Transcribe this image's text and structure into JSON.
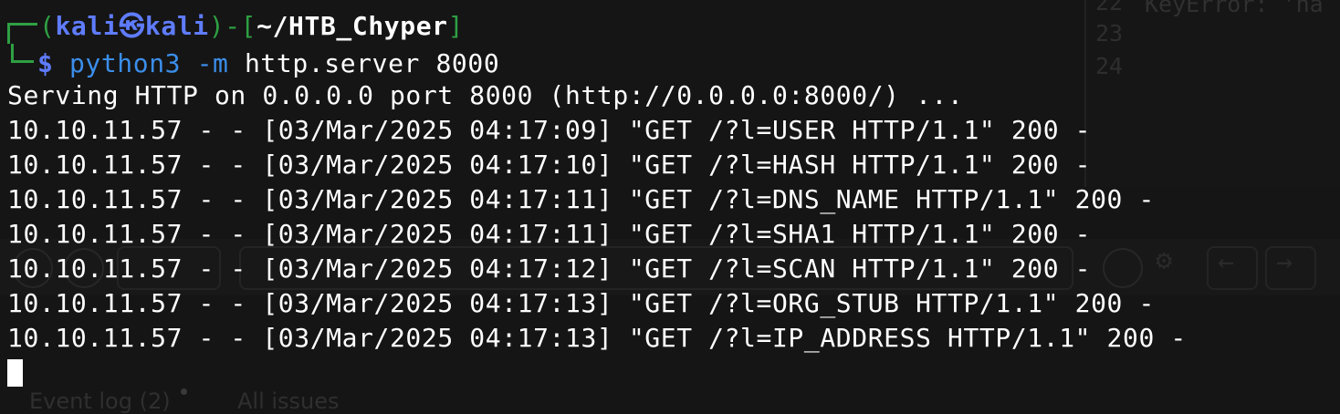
{
  "prompt": {
    "user": "kali",
    "at_symbol": "㉿",
    "host": "kali",
    "cwd": "~/HTB_Chyper",
    "dollar": "$",
    "command": "python3",
    "args": " -m",
    "rest": " http.server 8000"
  },
  "output": {
    "serving_line": "Serving HTTP on 0.0.0.0 port 8000 (http://0.0.0.0:8000/) ...",
    "log_lines": [
      "10.10.11.57 - - [03/Mar/2025 04:17:09] \"GET /?l=USER HTTP/1.1\" 200 -",
      "10.10.11.57 - - [03/Mar/2025 04:17:10] \"GET /?l=HASH HTTP/1.1\" 200 -",
      "10.10.11.57 - - [03/Mar/2025 04:17:11] \"GET /?l=DNS_NAME HTTP/1.1\" 200 -",
      "10.10.11.57 - - [03/Mar/2025 04:17:11] \"GET /?l=SHA1 HTTP/1.1\" 200 -",
      "10.10.11.57 - - [03/Mar/2025 04:17:12] \"GET /?l=SCAN HTTP/1.1\" 200 -",
      "10.10.11.57 - - [03/Mar/2025 04:17:13] \"GET /?l=ORG_STUB HTTP/1.1\" 200 -",
      "10.10.11.57 - - [03/Mar/2025 04:17:13] \"GET /?l=IP_ADDRESS HTTP/1.1\" 200 -"
    ]
  },
  "background": {
    "line_numbers": [
      "22",
      "23",
      "24"
    ],
    "code_snippet": "KeyError: 'na",
    "tabs": [
      "Event log (2)",
      "All issues"
    ]
  },
  "colors": {
    "background": "#151515",
    "prompt_blue": "#5f7cff",
    "prompt_green": "#2ea043",
    "command_blue": "#3b8eea",
    "text": "#ffffff"
  }
}
